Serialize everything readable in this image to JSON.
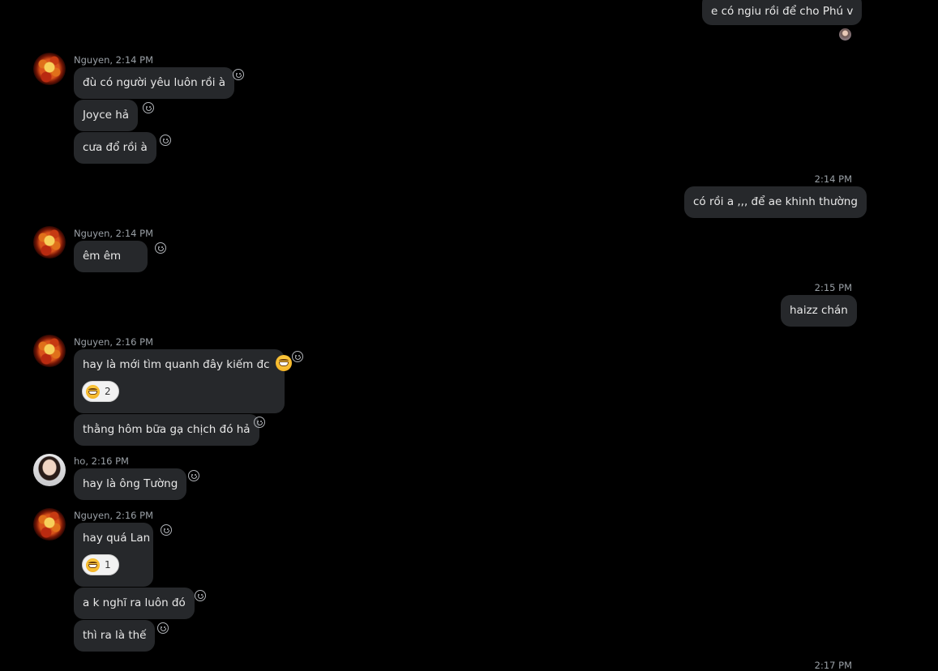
{
  "messages": {
    "m0": {
      "text": "e có ngiu rồi để cho Phú v"
    },
    "g1": {
      "sender": "Nguyen, 2:14 PM",
      "lines": [
        "đù có người yêu luôn rồi à",
        "Joyce hả",
        "cưa đổ rồi à"
      ]
    },
    "m1": {
      "time": "2:14 PM",
      "text": "có rồi a ,,, để ae khinh thường"
    },
    "g2": {
      "sender": "Nguyen, 2:14 PM",
      "lines": [
        "êm êm"
      ]
    },
    "m2": {
      "time": "2:15 PM",
      "text": "haizz chán"
    },
    "g3": {
      "sender": "Nguyen, 2:16 PM",
      "lines": [
        "hay là mới tìm quanh đây kiếm đc",
        "thằng hôm bữa gạ chịch đó hả"
      ],
      "reaction_count": "2"
    },
    "g4": {
      "sender": "ho, 2:16 PM",
      "lines": [
        "hay là ông Tường"
      ]
    },
    "g5": {
      "sender": "Nguyen, 2:16 PM",
      "lines": [
        "hay quá Lan",
        "a k nghĩ ra luôn đó",
        "thì ra là thế"
      ],
      "reaction_count": "1"
    },
    "m3": {
      "time": "2:17 PM"
    }
  },
  "icons": {
    "reaction": "smiley-outline-icon",
    "emoji": "grinning-face-icon"
  },
  "colors": {
    "background": "#000000",
    "bubble": "#26282b",
    "meta": "#9aa0a6"
  }
}
